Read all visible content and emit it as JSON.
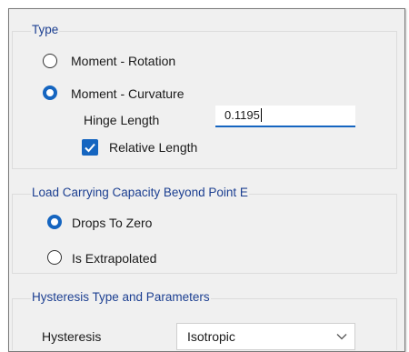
{
  "type_group": {
    "title": "Type",
    "options": [
      {
        "label": "Moment - Rotation",
        "selected": false
      },
      {
        "label": "Moment - Curvature",
        "selected": true
      }
    ],
    "hinge_length_label": "Hinge Length",
    "hinge_length_value": "0.1195",
    "relative_length_label": "Relative Length",
    "relative_length_checked": true
  },
  "capacity_group": {
    "title": "Load Carrying Capacity Beyond Point E",
    "options": [
      {
        "label": "Drops To Zero",
        "selected": true
      },
      {
        "label": "Is Extrapolated",
        "selected": false
      }
    ]
  },
  "hysteresis_group": {
    "title": "Hysteresis Type and Parameters",
    "hysteresis_label": "Hysteresis",
    "hysteresis_value": "Isotropic"
  },
  "colors": {
    "accent": "#1565c0",
    "group_title": "#1c3f91",
    "panel_bg": "#f0f0f0"
  },
  "icons": {
    "dropdown": "chevron-down-icon",
    "checkbox": "checkmark-icon"
  }
}
